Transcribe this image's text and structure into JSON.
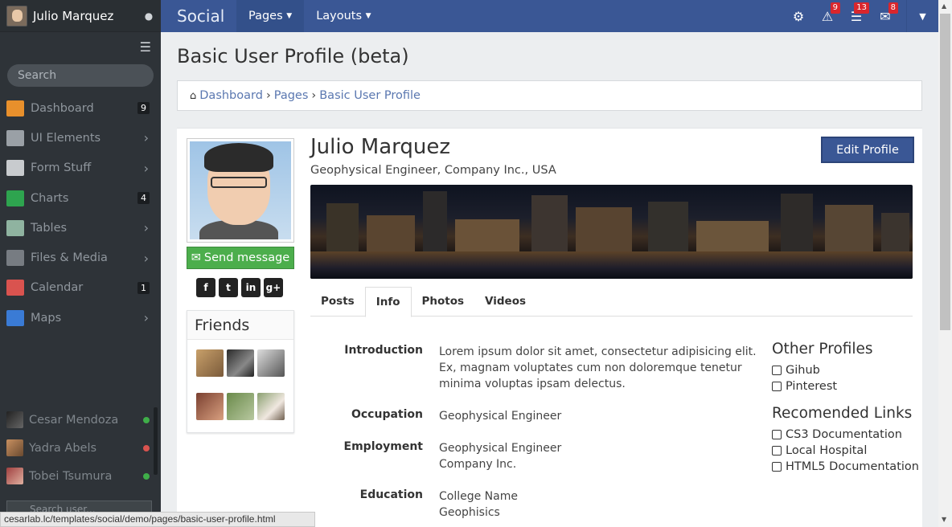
{
  "sidebar": {
    "user_name": "Julio Marquez",
    "search_placeholder": "Search",
    "items": [
      {
        "label": "Dashboard",
        "badge": "9",
        "icon": "home-icon",
        "color": "#e8902c"
      },
      {
        "label": "UI Elements",
        "icon": "server-icon",
        "color": "#9aa0a6"
      },
      {
        "label": "Form Stuff",
        "icon": "form-icon",
        "color": "#c8cbce"
      },
      {
        "label": "Charts",
        "badge": "4",
        "icon": "chart-icon",
        "color": "#2ea44f"
      },
      {
        "label": "Tables",
        "icon": "table-icon",
        "color": "#8fb3a0"
      },
      {
        "label": "Files & Media",
        "icon": "camera-icon",
        "color": "#777c82"
      },
      {
        "label": "Calendar",
        "badge": "1",
        "icon": "calendar-icon",
        "color": "#d9534f"
      },
      {
        "label": "Maps",
        "icon": "globe-icon",
        "color": "#3a7bd5"
      }
    ],
    "chat": [
      {
        "name": "Cesar Mendoza",
        "status_color": "#3fae49"
      },
      {
        "name": "Yadra Abels",
        "status_color": "#d9534f"
      },
      {
        "name": "Tobei Tsumura",
        "status_color": "#3fae49"
      }
    ],
    "chat_search_placeholder": "Search user..."
  },
  "topbar": {
    "brand": "Social",
    "menus": [
      "Pages",
      "Layouts"
    ],
    "badges": {
      "alerts": "9",
      "tasks": "13",
      "messages": "8"
    }
  },
  "page": {
    "title": "Basic User Profile (beta)",
    "breadcrumb": [
      "Dashboard",
      "Pages",
      "Basic User Profile"
    ]
  },
  "profile": {
    "name": "Julio Marquez",
    "subtitle": "Geophysical Engineer, Company Inc., USA",
    "edit_label": "Edit Profile",
    "send_label": "Send message",
    "friends_title": "Friends",
    "tabs": [
      "Posts",
      "Info",
      "Photos",
      "Videos"
    ],
    "active_tab": "Info",
    "info": {
      "intro_label": "Introduction",
      "intro_value": "Lorem ipsum dolor sit amet, consectetur adipisicing elit. Ex, magnam voluptates cum non doloremque tenetur minima voluptas ipsam delectus.",
      "occupation_label": "Occupation",
      "occupation_value": "Geophysical Engineer",
      "employment_label": "Employment",
      "employment_line1": "Geophysical Engineer",
      "employment_line2": "Company Inc.",
      "education_label": "Education",
      "education_line1": "College Name",
      "education_line2": "Geophisics"
    },
    "other_profiles_title": "Other Profiles",
    "other_profiles": [
      "Gihub",
      "Pinterest"
    ],
    "recommended_title": "Recomended Links",
    "recommended": [
      "CS3 Documentation",
      "Local Hospital",
      "HTML5 Documentation"
    ]
  },
  "statusbar": {
    "url": "cesarlab.lc/templates/social/demo/pages/basic-user-profile.html"
  }
}
